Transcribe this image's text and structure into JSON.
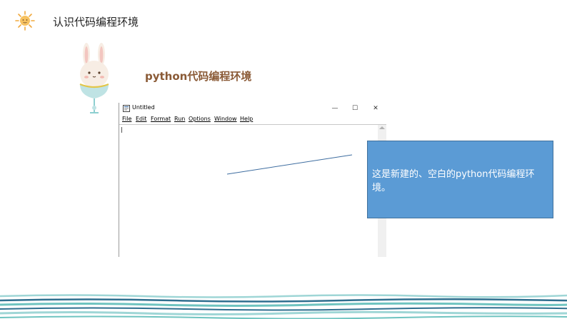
{
  "slide": {
    "title": "认识代码编程环境",
    "subtitle": "python代码编程环境"
  },
  "window": {
    "title": "Untitled",
    "buttons": {
      "minimize": "—",
      "maximize": "☐",
      "close": "✕"
    },
    "menu": [
      "File",
      "Edit",
      "Format",
      "Run",
      "Options",
      "Window",
      "Help"
    ]
  },
  "callout": {
    "text": "这是新建的、空白的python代码编程环境。"
  },
  "colors": {
    "subtitle": "#8a5a36",
    "callout_fill": "#5b9bd5",
    "callout_border": "#41719c",
    "wave_teal": "#6fc4c0",
    "wave_dark": "#2f6f8f",
    "wave_light": "#9fd6d6"
  },
  "icons": {
    "logo": "sun-icon",
    "decoration": "bunny-illustration",
    "app": "idle-app-icon"
  }
}
